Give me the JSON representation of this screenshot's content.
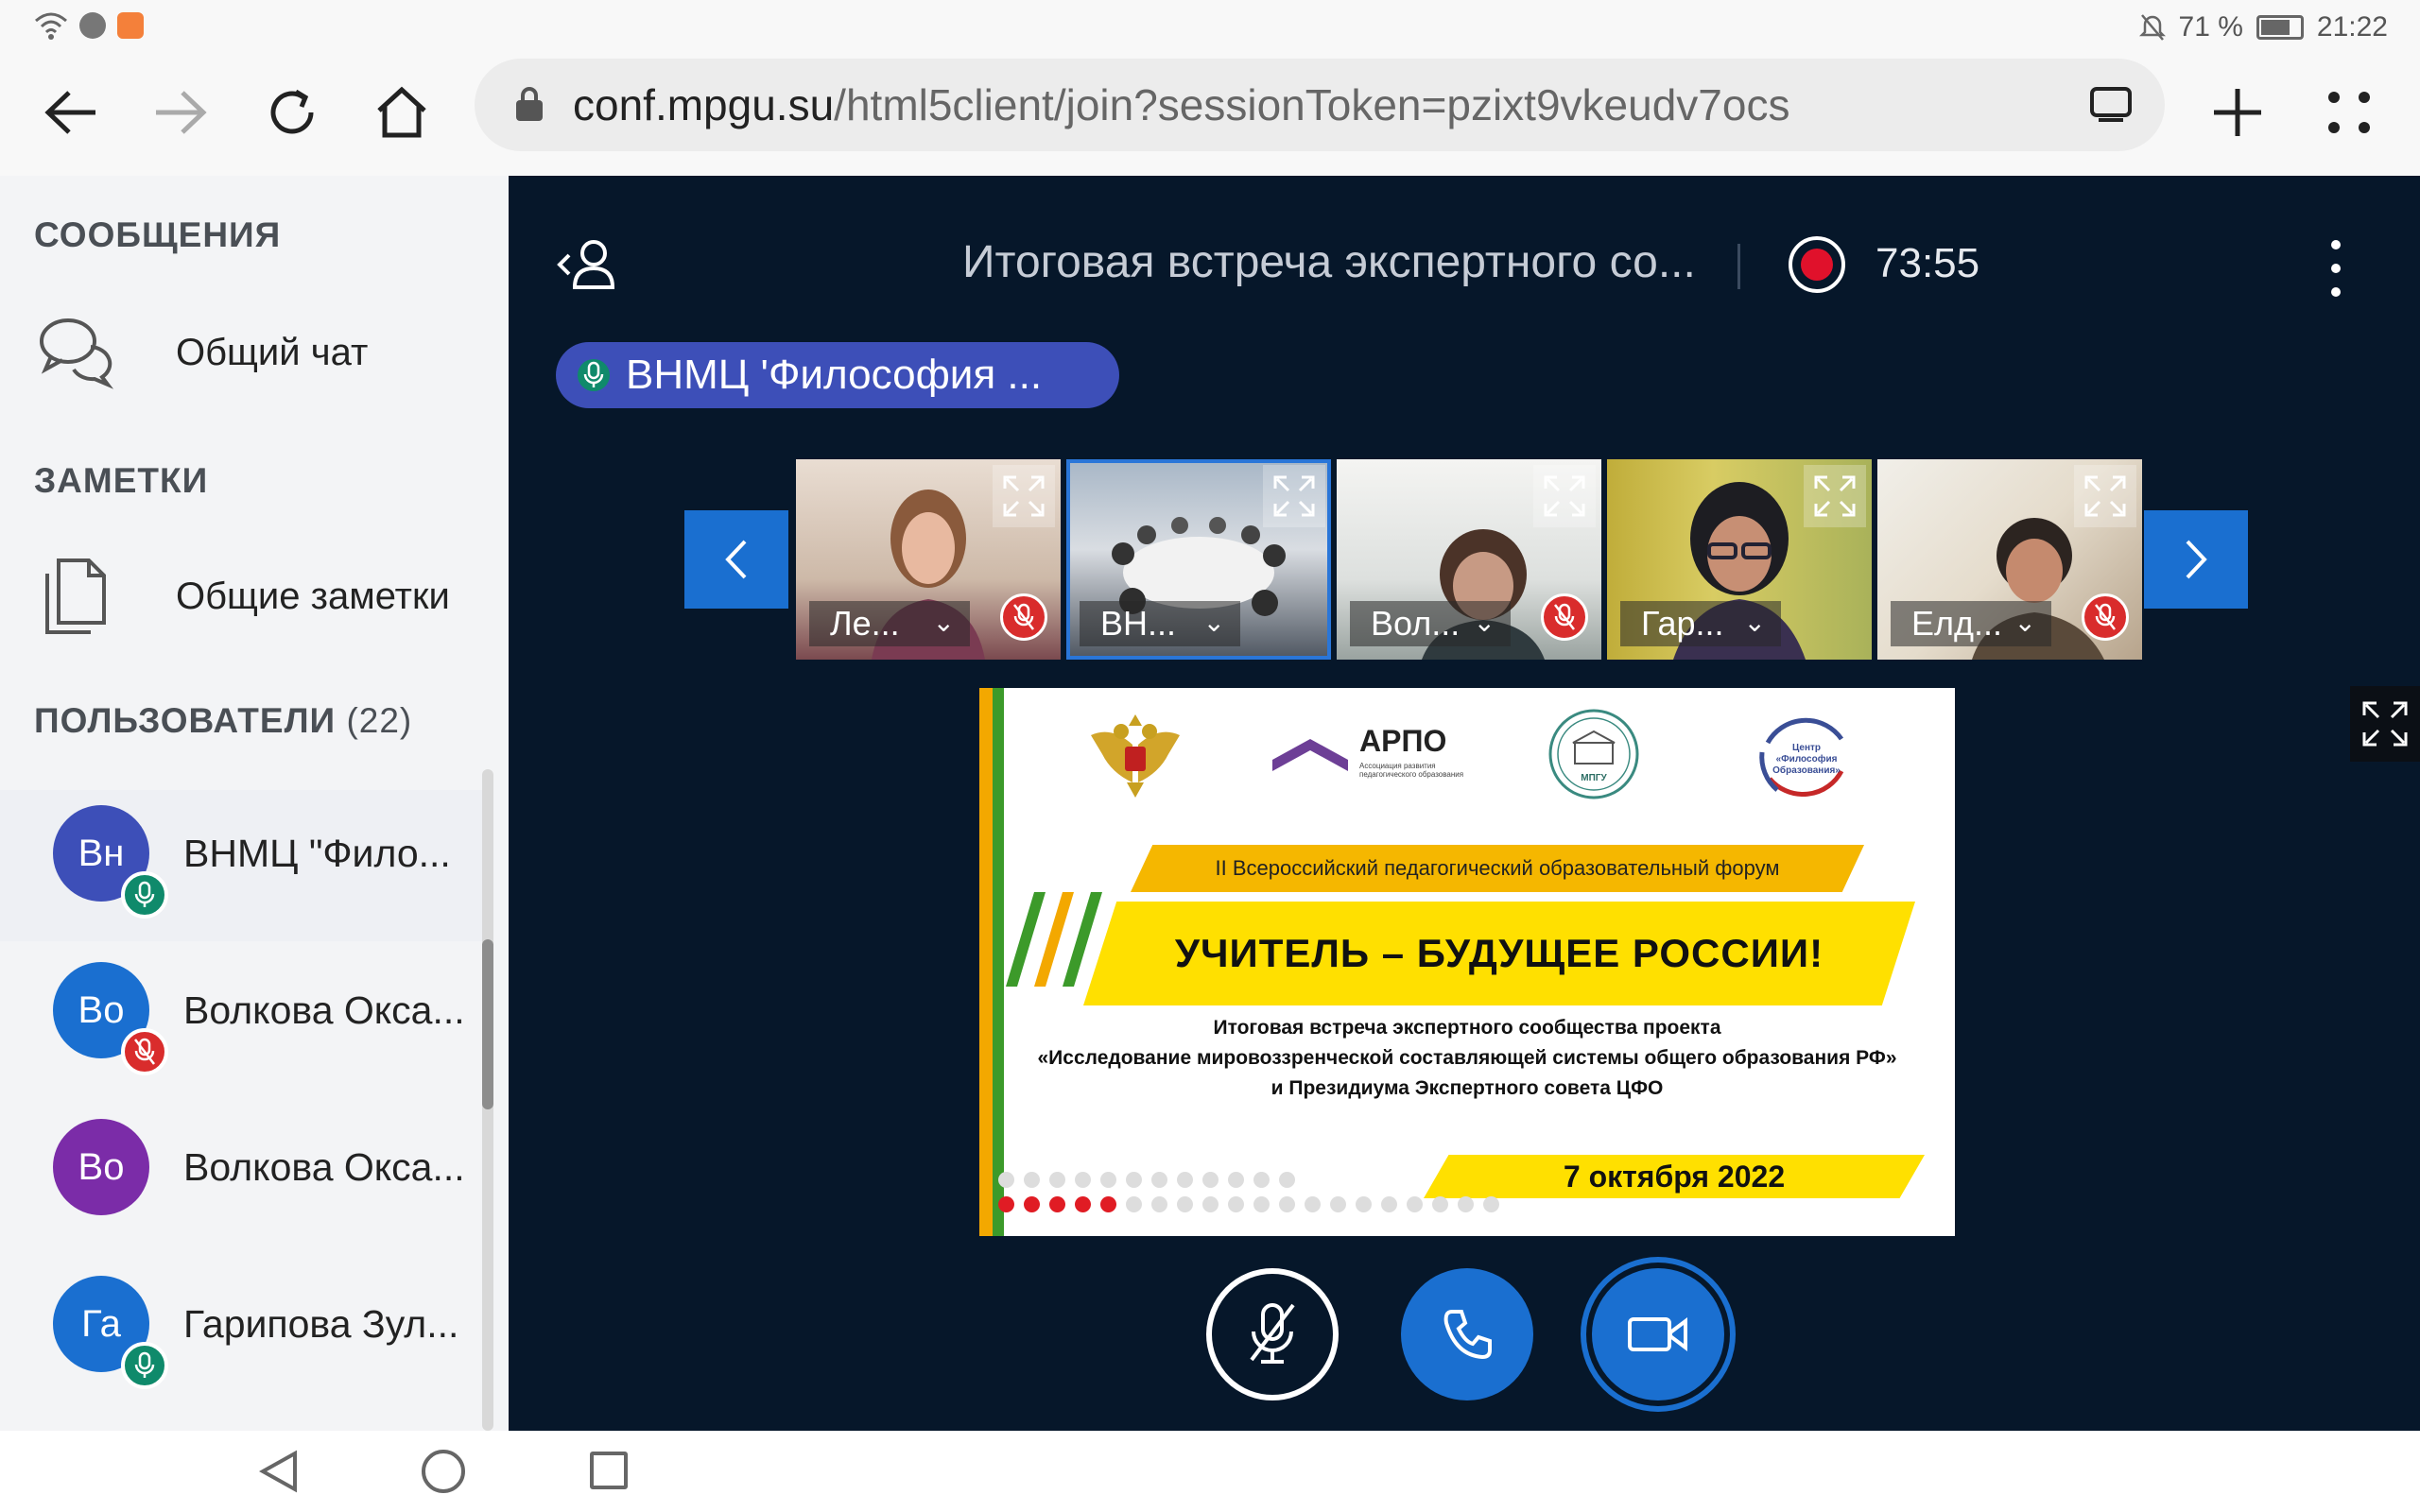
{
  "status": {
    "battery": "71 %",
    "time": "21:22"
  },
  "browser": {
    "url_host": "conf.mpgu.su",
    "url_path": "/html5client/join?sessionToken=pzixt9vkeudv7ocs"
  },
  "sidebar": {
    "messages_title": "СООБЩЕНИЯ",
    "public_chat": "Общий чат",
    "notes_title": "ЗАМЕТКИ",
    "shared_notes": "Общие заметки",
    "users_title": "ПОЛЬЗОВАТЕЛИ",
    "users_count": "(22)",
    "users": [
      {
        "initials": "Вн",
        "name": "ВНМЦ \"Фило...",
        "avatar_color": "#3d4fb8",
        "mic": "on"
      },
      {
        "initials": "Во",
        "name": "Волкова Окса...",
        "avatar_color": "#1a6fd0",
        "mic": "muted"
      },
      {
        "initials": "Во",
        "name": "Волкова Окса...",
        "avatar_color": "#7b2ca8",
        "mic": "none"
      },
      {
        "initials": "Га",
        "name": "Гарипова Зул...",
        "avatar_color": "#1a6fd0",
        "mic": "on"
      }
    ]
  },
  "meeting": {
    "title": "Итоговая встреча экспертного со...",
    "timer": "73:55",
    "talking": "ВНМЦ 'Философия ...",
    "tiles": [
      {
        "name": "Ле...",
        "muted": true
      },
      {
        "name": "ВН...",
        "muted": false
      },
      {
        "name": "Вол...",
        "muted": true
      },
      {
        "name": "Гар...",
        "muted": false
      },
      {
        "name": "Елд...",
        "muted": true
      }
    ]
  },
  "slide": {
    "arpo": "АРПО",
    "arpo_sub": "Ассоциация развития педагогического образования",
    "mpgu": "МПГУ",
    "cfo": "Центр «Философия Образования»",
    "forum": "II Всероссийский  педагогический образовательный форум",
    "slogan": "УЧИТЕЛЬ – БУДУЩЕЕ РОССИИ!",
    "desc_1": "Итоговая встреча экспертного сообщества проекта",
    "desc_2": "«Исследование мировоззренческой составляющей системы общего образования РФ»",
    "desc_3": "и Президиума Экспертного совета ЦФО",
    "date": "7 октября 2022"
  },
  "colors": {
    "accent": "#1a6fd0",
    "main_bg": "#06172a",
    "talking": "#3d4fb8",
    "mute_red": "#d92c2c",
    "mic_green": "#0f8a6b"
  }
}
